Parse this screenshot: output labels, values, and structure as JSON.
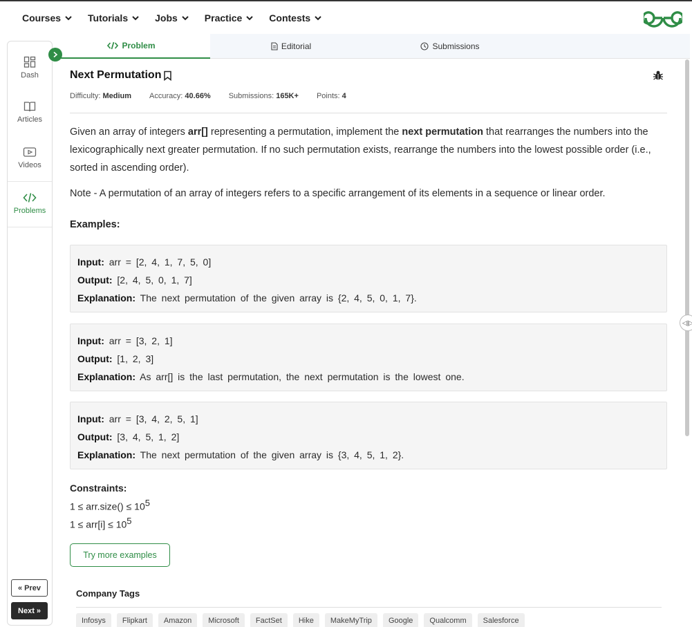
{
  "nav": {
    "items": [
      {
        "label": "Courses"
      },
      {
        "label": "Tutorials"
      },
      {
        "label": "Jobs"
      },
      {
        "label": "Practice"
      },
      {
        "label": "Contests"
      }
    ]
  },
  "colors": {
    "brand": "#2f8d46"
  },
  "sidebar": {
    "items": [
      {
        "label": "Dash",
        "icon": "dashboard-icon"
      },
      {
        "label": "Articles",
        "icon": "book-icon"
      },
      {
        "label": "Videos",
        "icon": "video-icon"
      },
      {
        "label": "Problems",
        "icon": "code-icon",
        "active": true
      }
    ],
    "prev_label": "Prev",
    "next_label": "Next"
  },
  "tabs": [
    {
      "label": "Problem",
      "active": true
    },
    {
      "label": "Editorial"
    },
    {
      "label": "Submissions"
    }
  ],
  "problem": {
    "title": "Next Permutation",
    "meta": {
      "difficulty_label": "Difficulty:",
      "difficulty": "Medium",
      "accuracy_label": "Accuracy:",
      "accuracy": "40.66%",
      "submissions_label": "Submissions:",
      "submissions": "165K+",
      "points_label": "Points:",
      "points": "4"
    },
    "desc": {
      "p1": "Given an array of integers ",
      "b1": "arr[]",
      "p2": " representing a permutation, implement the ",
      "b2": "next permutation",
      "p3": " that rearranges the numbers into the lexicographically next greater permutation. If no such permutation exists, rearrange the numbers into the lowest possible order (i.e., sorted in ascending order)."
    },
    "note": "Note - A permutation of an array of integers refers to a specific arrangement of its elements in a sequence or linear order.",
    "examples_heading": "Examples:",
    "examples": [
      {
        "input_label": "Input:",
        "input": "arr = [2, 4, 1, 7, 5, 0]",
        "output_label": "Output:",
        "output": "[2, 4, 5, 0, 1, 7]",
        "explanation_label": "Explanation:",
        "explanation": "The next permutation of the given array is {2, 4, 5, 0, 1, 7}."
      },
      {
        "input_label": "Input:",
        "input": "arr = [3, 2, 1]",
        "output_label": "Output:",
        "output": "[1, 2, 3]",
        "explanation_label": "Explanation:",
        "explanation": "As arr[] is the last permutation, the next permutation is the lowest one."
      },
      {
        "input_label": "Input:",
        "input": "arr = [3, 4, 2, 5, 1]",
        "output_label": "Output:",
        "output": "[3, 4, 5, 1, 2]",
        "explanation_label": "Explanation:",
        "explanation": "The next permutation of the given array is {3, 4, 5, 1, 2}."
      }
    ],
    "constraints_heading": "Constraints:",
    "constraints": [
      {
        "text": "1 ≤ arr.size() ≤ 10",
        "exp": "5"
      },
      {
        "text": "1 ≤ arr[i] ≤ 10",
        "exp": "5"
      }
    ],
    "try_button": "Try more examples"
  },
  "company": {
    "heading": "Company Tags",
    "tags": [
      "Infosys",
      "Flipkart",
      "Amazon",
      "Microsoft",
      "FactSet",
      "Hike",
      "MakeMyTrip",
      "Google",
      "Qualcomm",
      "Salesforce"
    ]
  }
}
